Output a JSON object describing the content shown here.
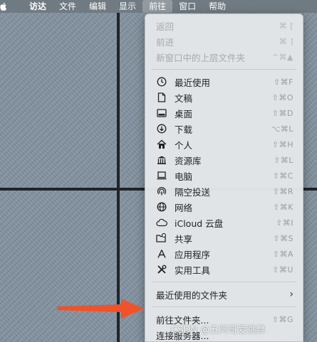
{
  "menubar": {
    "items": [
      {
        "label": "访达",
        "bold": true
      },
      {
        "label": "文件"
      },
      {
        "label": "编辑"
      },
      {
        "label": "显示"
      },
      {
        "label": "前往",
        "active": true
      },
      {
        "label": "窗口"
      },
      {
        "label": "帮助"
      }
    ]
  },
  "menu": {
    "group1": [
      {
        "label": "返回",
        "shortcut": "⌘ [",
        "disabled": true
      },
      {
        "label": "前进",
        "shortcut": "⌘ ]",
        "disabled": true
      },
      {
        "label": "新窗口中的上层文件夹",
        "shortcut": "^⌘▲",
        "disabled": true
      }
    ],
    "group2": [
      {
        "label": "最近使用",
        "shortcut": "⇧⌘F",
        "icon": "clock-icon"
      },
      {
        "label": "文稿",
        "shortcut": "⇧⌘O",
        "icon": "document-icon"
      },
      {
        "label": "桌面",
        "shortcut": "⇧⌘D",
        "icon": "desktop-icon"
      },
      {
        "label": "下载",
        "shortcut": "⌥⌘L",
        "icon": "download-icon"
      },
      {
        "label": "个人",
        "shortcut": "⇧⌘H",
        "icon": "home-icon"
      },
      {
        "label": "资源库",
        "shortcut": "⇧⌘L",
        "icon": "library-icon"
      },
      {
        "label": "电脑",
        "shortcut": "⇧⌘C",
        "icon": "computer-icon"
      },
      {
        "label": "隔空投送",
        "shortcut": "⇧⌘R",
        "icon": "airdrop-icon"
      },
      {
        "label": "网络",
        "shortcut": "⇧⌘K",
        "icon": "globe-icon"
      },
      {
        "label": "iCloud 云盘",
        "shortcut": "⇧⌘I",
        "icon": "cloud-icon"
      },
      {
        "label": "共享",
        "shortcut": "⇧⌘S",
        "icon": "shared-folder-icon"
      },
      {
        "label": "应用程序",
        "shortcut": "⇧⌘A",
        "icon": "applications-icon"
      },
      {
        "label": "实用工具",
        "shortcut": "⇧⌘U",
        "icon": "utilities-icon"
      }
    ],
    "recent_folders": {
      "label": "最近使用的文件夹"
    },
    "group3": [
      {
        "label": "前往文件夹...",
        "shortcut": "⇧⌘G"
      },
      {
        "label": "连接服务器...",
        "shortcut": ""
      }
    ]
  },
  "watermark": "CSDN @五阿哥爱跳舞",
  "colors": {
    "arrow": "#f0522a",
    "menu_bg": "#e3e6e9",
    "menubar_bg": "#6e7880"
  }
}
